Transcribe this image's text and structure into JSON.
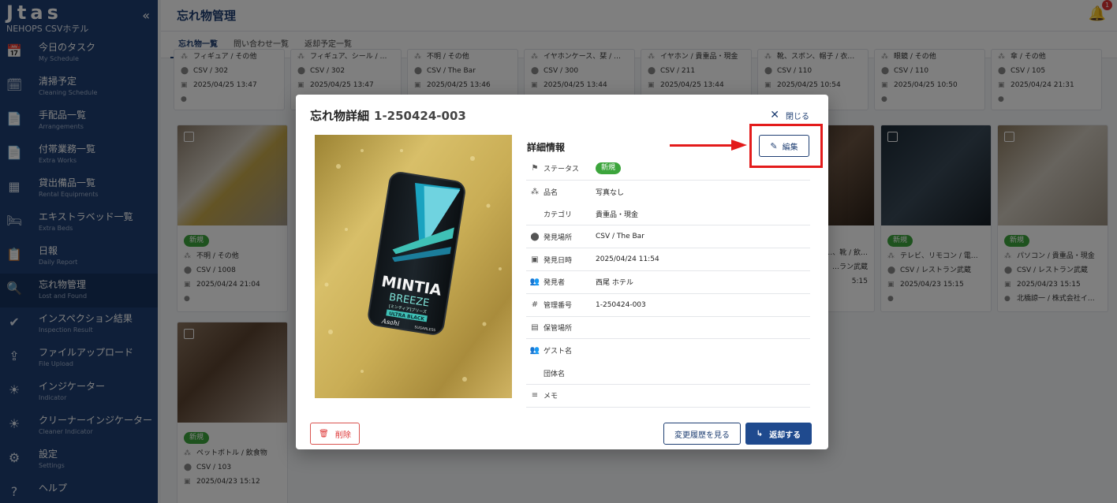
{
  "sidebar": {
    "logo": "Jtas",
    "hotel": "NEHOPS CSVホテル",
    "collapse_icon": "«",
    "items": [
      {
        "label": "今日のタスク",
        "sub": "My Schedule"
      },
      {
        "label": "清掃予定",
        "sub": "Cleaning Schedule"
      },
      {
        "label": "手配品一覧",
        "sub": "Arrangements"
      },
      {
        "label": "付帯業務一覧",
        "sub": "Extra Works"
      },
      {
        "label": "貸出備品一覧",
        "sub": "Rental Equipments"
      },
      {
        "label": "エキストラベッド一覧",
        "sub": "Extra Beds"
      },
      {
        "label": "日報",
        "sub": "Daily Report"
      },
      {
        "label": "忘れ物管理",
        "sub": "Lost and Found"
      },
      {
        "label": "インスペクション結果",
        "sub": "Inspection Result"
      },
      {
        "label": "ファイルアップロード",
        "sub": "File Upload"
      },
      {
        "label": "インジケーター",
        "sub": "Indicator"
      },
      {
        "label": "クリーナーインジケーター",
        "sub": "Cleaner Indicator"
      },
      {
        "label": "設定",
        "sub": "Settings"
      },
      {
        "label": "ヘルプ",
        "sub": ""
      }
    ]
  },
  "header": {
    "title": "忘れ物管理",
    "notification_count": "1"
  },
  "tabs": [
    "忘れ物一覧",
    "問い合わせ一覧",
    "返却予定一覧"
  ],
  "cards_top": [
    {
      "item": "フィギュア / その他",
      "loc": "CSV / 302",
      "date": "2025/04/25 13:47"
    },
    {
      "item": "フィギュア、シール / …",
      "loc": "CSV / 302",
      "date": "2025/04/25 13:47"
    },
    {
      "item": "不明 / その他",
      "loc": "CSV / The Bar",
      "date": "2025/04/25 13:46"
    },
    {
      "item": "イヤホンケース、栞 / …",
      "loc": "CSV / 300",
      "date": "2025/04/25 13:44"
    },
    {
      "item": "イヤホン / 貴重品・現金",
      "loc": "CSV / 211",
      "date": "2025/04/25 13:44"
    },
    {
      "item": "靴、スボン、帽子 / 衣…",
      "loc": "CSV / 110",
      "date": "2025/04/25 10:54"
    },
    {
      "item": "眼鏡 / その他",
      "loc": "CSV / 110",
      "date": "2025/04/25 10:50"
    },
    {
      "item": "傘 / その他",
      "loc": "CSV / 105",
      "date": "2025/04/24 21:31"
    }
  ],
  "cards_mid": [
    {
      "badge": "新規",
      "item": "不明 / その他",
      "loc": "CSV / 1008",
      "date": "2025/04/24 21:04",
      "person": ""
    },
    {
      "badge": "新規",
      "item": "テレビ、リモコン / 電…",
      "loc": "CSV / レストラン武蔵",
      "date": "2025/04/23 15:15",
      "person": ""
    },
    {
      "badge": "新規",
      "item": "パソコン / 貴重品・現金",
      "loc": "CSV / レストラン武蔵",
      "date": "2025/04/23 15:15",
      "person": "北橋諒一 / 株式会社イ…"
    }
  ],
  "card_partial": {
    "item": "…、靴 / 飲…",
    "loc": "…ラン武蔵",
    "date": "5:15"
  },
  "cards_bottom": [
    {
      "badge": "新規",
      "item": "ペットボトル / 飲食物",
      "loc": "CSV / 103",
      "date": "2025/04/23 15:12"
    }
  ],
  "modal": {
    "title": "忘れ物詳細",
    "number": "1-250424-003",
    "close_label": "閉じる",
    "section_title": "詳細情報",
    "edit_label": "編集",
    "rows": [
      {
        "label": "ステータス",
        "value": "新規"
      },
      {
        "label": "品名",
        "value": "写真なし"
      },
      {
        "label": "カテゴリ",
        "value": "貴重品・現金"
      },
      {
        "label": "発見場所",
        "value": "CSV / The Bar"
      },
      {
        "label": "発見日時",
        "value": "2025/04/24 11:54"
      },
      {
        "label": "発見者",
        "value": "西尾 ホテル"
      },
      {
        "label": "管理番号",
        "value": "1-250424-003"
      },
      {
        "label": "保管場所",
        "value": ""
      },
      {
        "label": "ゲスト名",
        "value": ""
      },
      {
        "label": "団体名",
        "value": ""
      },
      {
        "label": "メモ",
        "value": ""
      }
    ],
    "photo": {
      "brand": "MINTIA",
      "flavor": "BREEZE",
      "variant": "ULTRA BLACK",
      "maker": "Asahi",
      "sub": "SUGARLESS",
      "kana": "[ミンティア]ブリーズ"
    },
    "delete_label": "削除",
    "history_label": "変更履歴を見る",
    "return_label": "返却する"
  },
  "colors": {
    "sidebar": "#1f3f73",
    "accent": "#1f4a8e",
    "new_badge": "#3ca53c",
    "annotation": "#e31b1b"
  }
}
